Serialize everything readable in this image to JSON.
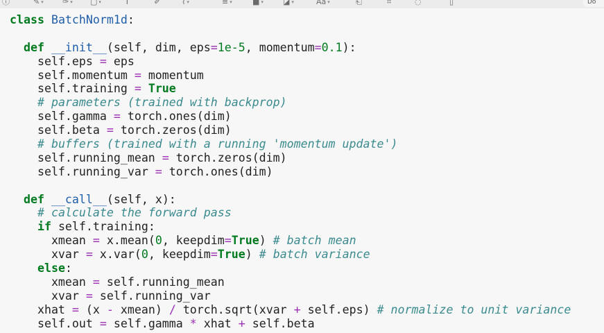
{
  "toolbar": {
    "icons": [
      {
        "name": "info-icon",
        "glyph": "ⓘ",
        "caret": false
      },
      {
        "name": "pen-icon",
        "glyph": "✎",
        "caret": true
      },
      {
        "name": "highlighter-icon",
        "glyph": "✑",
        "caret": true
      },
      {
        "name": "shape-icon",
        "glyph": "▢",
        "caret": true
      },
      {
        "name": "text-icon",
        "glyph": "T",
        "caret": false
      },
      {
        "name": "draw-icon",
        "glyph": "✐",
        "caret": false
      },
      {
        "name": "stamp-icon",
        "glyph": "⌇",
        "caret": true
      },
      {
        "name": "line-style-icon",
        "glyph": "≡",
        "caret": true
      },
      {
        "name": "border-color-icon",
        "glyph": "■",
        "caret": true
      },
      {
        "name": "fill-color-icon",
        "glyph": "◪",
        "caret": true
      },
      {
        "name": "font-icon",
        "glyph": "Aa",
        "caret": true
      },
      {
        "name": "rotate-icon",
        "glyph": "⎗",
        "caret": false
      },
      {
        "name": "crop-icon",
        "glyph": "⌗",
        "caret": false
      },
      {
        "name": "comment-icon",
        "glyph": "◌",
        "caret": false
      },
      {
        "name": "page-icon",
        "glyph": "▯",
        "caret": false
      }
    ],
    "right_label": "Do"
  },
  "code_lines": [
    [
      [
        "class ",
        "kw"
      ],
      [
        "BatchNorm1d",
        "cls"
      ],
      [
        ":",
        ""
      ]
    ],
    [],
    [
      [
        "  ",
        ""
      ],
      [
        "def ",
        "kw"
      ],
      [
        "__init__",
        "fn"
      ],
      [
        "(self, dim, eps",
        ""
      ],
      [
        "=",
        "op"
      ],
      [
        "1e-5",
        "num"
      ],
      [
        ", momentum",
        ""
      ],
      [
        "=",
        "op"
      ],
      [
        "0.1",
        "num"
      ],
      [
        "):",
        ""
      ]
    ],
    [
      [
        "    self.eps ",
        ""
      ],
      [
        "=",
        "op"
      ],
      [
        " eps",
        ""
      ]
    ],
    [
      [
        "    self.momentum ",
        ""
      ],
      [
        "=",
        "op"
      ],
      [
        " momentum",
        ""
      ]
    ],
    [
      [
        "    self.training ",
        ""
      ],
      [
        "=",
        "op"
      ],
      [
        " ",
        ""
      ],
      [
        "True",
        "kw"
      ]
    ],
    [
      [
        "    ",
        ""
      ],
      [
        "# parameters (trained with backprop)",
        "cm"
      ]
    ],
    [
      [
        "    self.gamma ",
        ""
      ],
      [
        "=",
        "op"
      ],
      [
        " torch.ones(dim)",
        ""
      ]
    ],
    [
      [
        "    self.beta ",
        ""
      ],
      [
        "=",
        "op"
      ],
      [
        " torch.zeros(dim)",
        ""
      ]
    ],
    [
      [
        "    ",
        ""
      ],
      [
        "# buffers (trained with a running 'momentum update')",
        "cm"
      ]
    ],
    [
      [
        "    self.running_mean ",
        ""
      ],
      [
        "=",
        "op"
      ],
      [
        " torch.zeros(dim)",
        ""
      ]
    ],
    [
      [
        "    self.running_var ",
        ""
      ],
      [
        "=",
        "op"
      ],
      [
        " torch.ones(dim)",
        ""
      ]
    ],
    [],
    [
      [
        "  ",
        ""
      ],
      [
        "def ",
        "kw"
      ],
      [
        "__call__",
        "fn"
      ],
      [
        "(self, x):",
        ""
      ]
    ],
    [
      [
        "    ",
        ""
      ],
      [
        "# calculate the forward pass",
        "cm"
      ]
    ],
    [
      [
        "    ",
        ""
      ],
      [
        "if",
        "kw"
      ],
      [
        " self.training:",
        ""
      ]
    ],
    [
      [
        "      xmean ",
        ""
      ],
      [
        "=",
        "op"
      ],
      [
        " x.mean(",
        ""
      ],
      [
        "0",
        "num"
      ],
      [
        ", keepdim",
        ""
      ],
      [
        "=",
        "op"
      ],
      [
        "True",
        "kw"
      ],
      [
        ") ",
        ""
      ],
      [
        "# batch mean",
        "cm"
      ]
    ],
    [
      [
        "      xvar ",
        ""
      ],
      [
        "=",
        "op"
      ],
      [
        " x.var(",
        ""
      ],
      [
        "0",
        "num"
      ],
      [
        ", keepdim",
        ""
      ],
      [
        "=",
        "op"
      ],
      [
        "True",
        "kw"
      ],
      [
        ") ",
        ""
      ],
      [
        "# batch variance",
        "cm"
      ]
    ],
    [
      [
        "    ",
        ""
      ],
      [
        "else",
        "kw"
      ],
      [
        ":",
        ""
      ]
    ],
    [
      [
        "      xmean ",
        ""
      ],
      [
        "=",
        "op"
      ],
      [
        " self.running_mean",
        ""
      ]
    ],
    [
      [
        "      xvar ",
        ""
      ],
      [
        "=",
        "op"
      ],
      [
        " self.running_var",
        ""
      ]
    ],
    [
      [
        "    xhat ",
        ""
      ],
      [
        "=",
        "op"
      ],
      [
        " (x ",
        ""
      ],
      [
        "-",
        "op"
      ],
      [
        " xmean) ",
        ""
      ],
      [
        "/",
        "op"
      ],
      [
        " torch.sqrt(xvar ",
        ""
      ],
      [
        "+",
        "op"
      ],
      [
        " self.eps) ",
        ""
      ],
      [
        "# normalize to unit variance",
        "cm"
      ]
    ],
    [
      [
        "    self.out ",
        ""
      ],
      [
        "=",
        "op"
      ],
      [
        " self.gamma ",
        ""
      ],
      [
        "*",
        "op"
      ],
      [
        " xhat ",
        ""
      ],
      [
        "+",
        "op"
      ],
      [
        " self.beta",
        ""
      ]
    ]
  ]
}
